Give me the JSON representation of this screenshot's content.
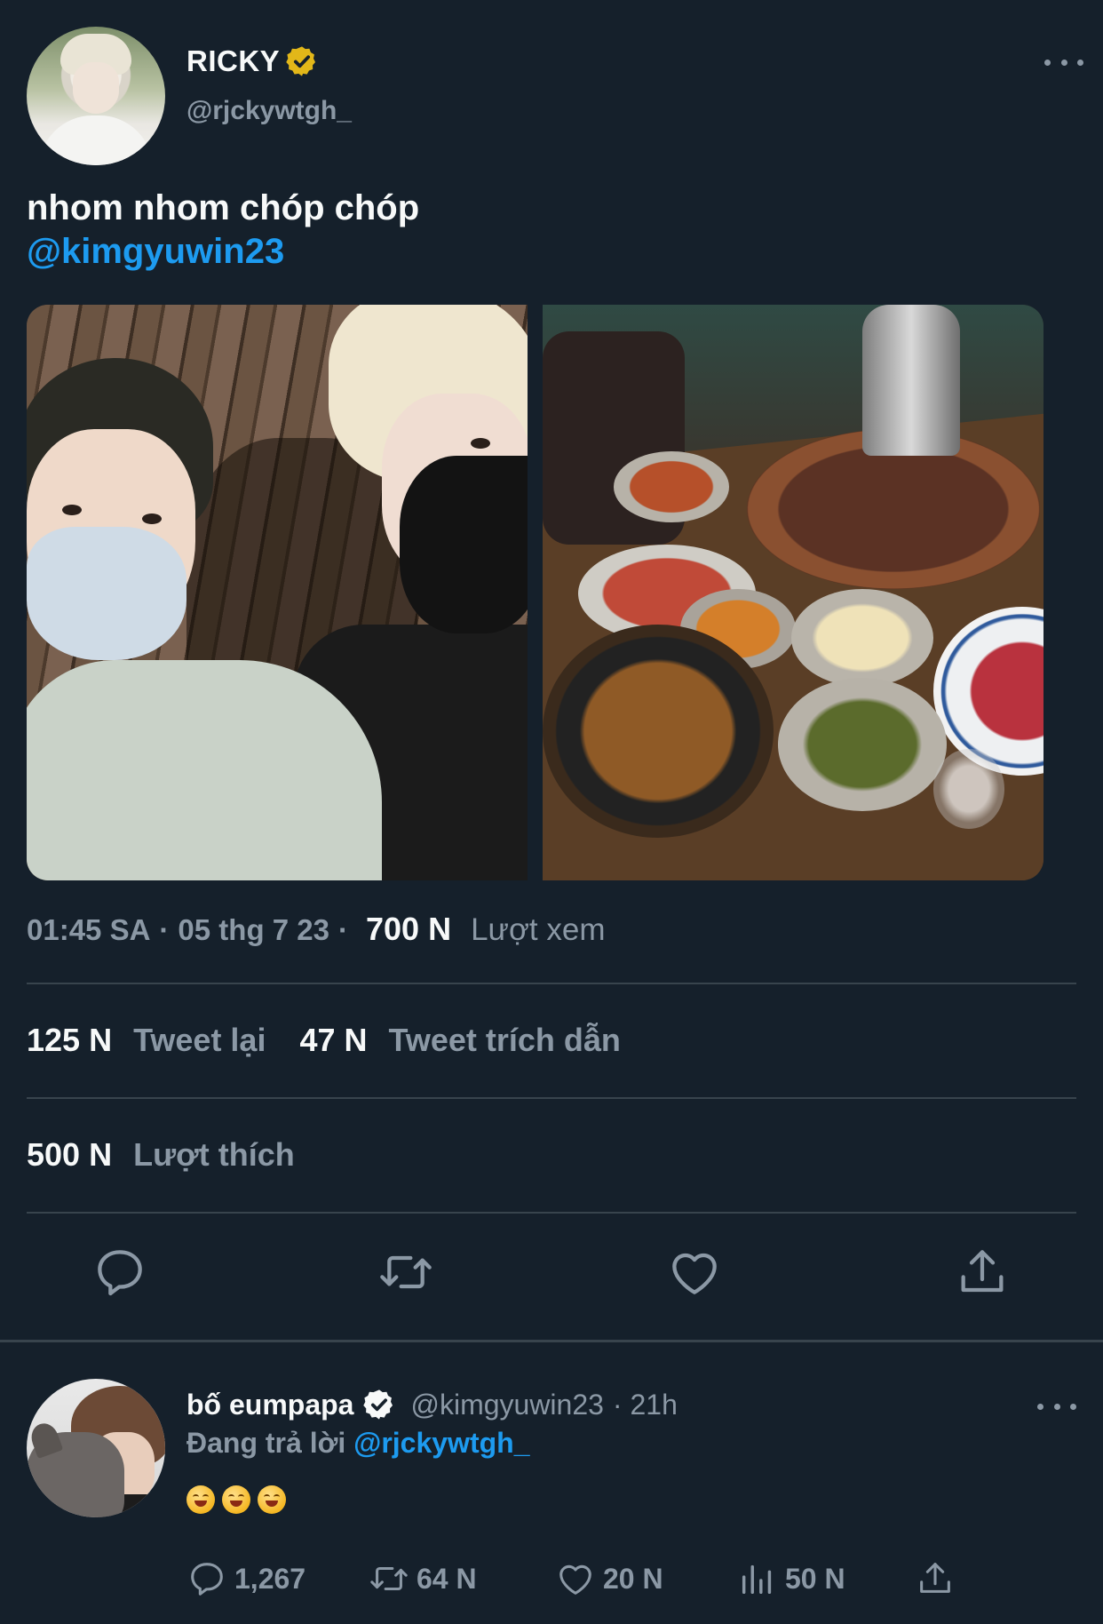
{
  "tweet": {
    "display_name": "RICKY",
    "handle": "@rjckywtgh_",
    "text": "nhom nhom chóp chóp",
    "mention": "@kimgyuwin23",
    "time": "01:45 SA",
    "date": "05 thg 7 23",
    "separator": "·",
    "views_count": "700 N",
    "views_label": "Lượt xem"
  },
  "stats": {
    "retweets_count": "125 N",
    "retweets_label": "Tweet lại",
    "quotes_count": "47 N",
    "quotes_label": "Tweet trích dẫn",
    "likes_count": "500 N",
    "likes_label": "Lượt thích"
  },
  "actions": {
    "icons": [
      "reply-icon",
      "retweet-icon",
      "like-icon",
      "share-icon"
    ]
  },
  "reply": {
    "display_name": "bố eumpapa",
    "handle": "@kimgyuwin23",
    "time": "· 21h",
    "replying_prefix": "Đang trả lời",
    "replying_to": "@rjckywtgh_",
    "emoji_count": 3,
    "replies_count": "1,267",
    "retweets_count": "64 N",
    "likes_count": "20 N",
    "views_count": "50 N"
  },
  "colors": {
    "background": "#15202b",
    "text": "#f7f9f9",
    "secondary": "#8b98a5",
    "accent": "#1d9bf0",
    "divider": "#38444d",
    "verified_gold": "#e2b719",
    "verified_blue": "#f7f9f9"
  }
}
